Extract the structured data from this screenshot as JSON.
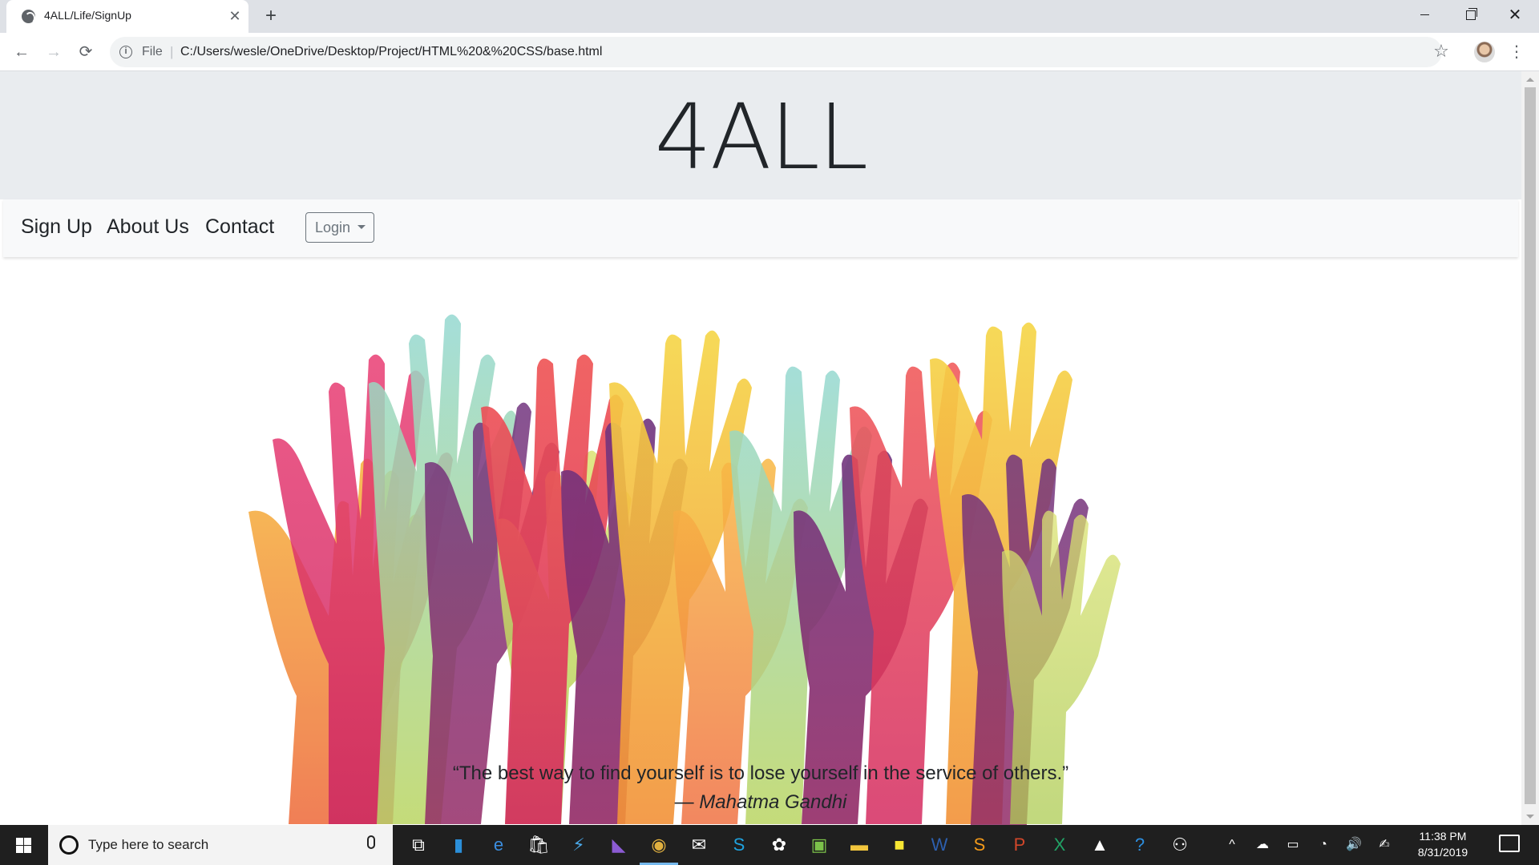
{
  "browser": {
    "tab_title": "4ALL/Life/SignUp",
    "tab_close": "✕",
    "new_tab": "+",
    "scheme_label": "File",
    "url": "C:/Users/wesle/OneDrive/Desktop/Project/HTML%20&%20CSS/base.html",
    "back": "←",
    "forward": "→",
    "reload": "⟳",
    "bookmark": "☆",
    "menu": "⋮",
    "window_close": "✕"
  },
  "page": {
    "brand": "4ALL",
    "nav": {
      "signup": "Sign Up",
      "about": "About Us",
      "contact": "Contact",
      "login": "Login"
    },
    "quote": "“The best way to find yourself is to lose yourself in the service of others.”",
    "attribution_dash": "— ",
    "attribution_name": "Mahatma Gandhi"
  },
  "taskbar": {
    "search_placeholder": "Type here to search",
    "time": "11:38 PM",
    "date": "8/31/2019",
    "apps": [
      {
        "name": "task-view-icon",
        "glyph": "⧉",
        "color": "#ffffff"
      },
      {
        "name": "file-app-icon",
        "glyph": "▮",
        "color": "#2b8fd9"
      },
      {
        "name": "edge-icon",
        "glyph": "e",
        "color": "#3b8ee0"
      },
      {
        "name": "store-icon",
        "glyph": "🛍",
        "color": "#ffffff"
      },
      {
        "name": "azure-icon",
        "glyph": "⚡",
        "color": "#4aa8e8"
      },
      {
        "name": "visual-studio-icon",
        "glyph": "◣",
        "color": "#8c5bd4"
      },
      {
        "name": "chrome-icon",
        "glyph": "◉",
        "color": "#e0b040"
      },
      {
        "name": "mail-icon",
        "glyph": "✉",
        "color": "#ffffff"
      },
      {
        "name": "skype-icon",
        "glyph": "S",
        "color": "#1fa3e0"
      },
      {
        "name": "paint-icon",
        "glyph": "✿",
        "color": "#ffffff"
      },
      {
        "name": "photos-edit-icon",
        "glyph": "▣",
        "color": "#7cc24a"
      },
      {
        "name": "file-explorer-icon",
        "glyph": "▬",
        "color": "#f2c53d"
      },
      {
        "name": "sticky-notes-icon",
        "glyph": "■",
        "color": "#f7e733"
      },
      {
        "name": "word-icon",
        "glyph": "W",
        "color": "#2d5fae"
      },
      {
        "name": "sublime-icon",
        "glyph": "S",
        "color": "#f39a1a"
      },
      {
        "name": "powerpoint-icon",
        "glyph": "P",
        "color": "#d2472a"
      },
      {
        "name": "excel-icon",
        "glyph": "X",
        "color": "#21a366"
      },
      {
        "name": "photos-icon",
        "glyph": "▲",
        "color": "#ffffff"
      },
      {
        "name": "help-icon",
        "glyph": "?",
        "color": "#2d8fe0"
      },
      {
        "name": "people-icon",
        "glyph": "⚇",
        "color": "#ffffff"
      }
    ],
    "tray": [
      "^",
      "☁",
      "▭",
      "◔",
      "🔊",
      "✍"
    ]
  }
}
